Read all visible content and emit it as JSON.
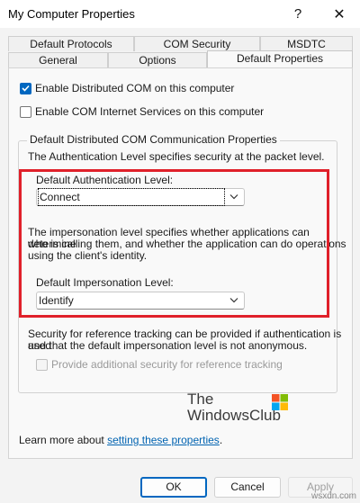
{
  "window": {
    "title": "My Computer Properties",
    "help_glyph": "?",
    "close_glyph": "✕"
  },
  "tabs": {
    "row_back": [
      "Default Protocols",
      "COM Security",
      "MSDTC"
    ],
    "row_front": [
      "General",
      "Options",
      "Default Properties"
    ],
    "active": "Default Properties"
  },
  "options": {
    "enable_dcom": {
      "label": "Enable Distributed COM on this computer",
      "checked": true
    },
    "enable_cis": {
      "label": "Enable COM Internet Services on this computer",
      "checked": false
    }
  },
  "group": {
    "title": "Default Distributed COM Communication Properties",
    "auth_desc": "The Authentication Level specifies security at the packet level.",
    "auth_label": "Default Authentication Level:",
    "auth_value": "Connect",
    "imp_desc_1": "The impersonation level specifies whether applications can determine",
    "imp_desc_2": "who is calling them, and whether the application can do operations",
    "imp_desc_3": "using the client's identity.",
    "imp_label": "Default Impersonation Level:",
    "imp_value": "Identify",
    "ref_desc_1": "Security for reference tracking can be provided if authentication is used",
    "ref_desc_2": "and that the default impersonation level is not anonymous.",
    "ref_check": {
      "label": "Provide additional security for reference tracking",
      "checked": false,
      "disabled": true
    }
  },
  "logo": {
    "line1": "The",
    "line2": "WindowsClub"
  },
  "learn_more": {
    "prefix": "Learn more about ",
    "link": "setting these properties",
    "suffix": "."
  },
  "buttons": {
    "ok": "OK",
    "cancel": "Cancel",
    "apply": "Apply"
  },
  "watermark": "wsxdn.com",
  "colors": {
    "accent": "#0067c0",
    "highlight_border": "#e0202a",
    "link": "#0063b1"
  }
}
